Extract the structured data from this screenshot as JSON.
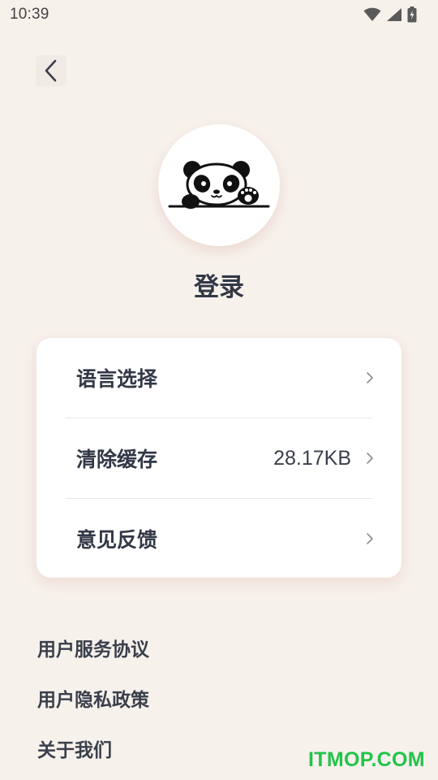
{
  "status_bar": {
    "time": "10:39",
    "icons": [
      "wifi-icon",
      "signal-icon",
      "battery-charging-icon"
    ]
  },
  "header": {
    "back_icon": "chevron-left-icon"
  },
  "profile": {
    "avatar": "panda-avatar",
    "login_label": "登录"
  },
  "settings": {
    "items": [
      {
        "label": "语言选择",
        "value": "",
        "icon": "chevron-right-icon"
      },
      {
        "label": "清除缓存",
        "value": "28.17KB",
        "icon": "chevron-right-icon"
      },
      {
        "label": "意见反馈",
        "value": "",
        "icon": "chevron-right-icon"
      }
    ]
  },
  "links": {
    "items": [
      {
        "label": "用户服务协议"
      },
      {
        "label": "用户隐私政策"
      },
      {
        "label": "关于我们"
      }
    ]
  },
  "watermark": "ITMOP.COM",
  "colors": {
    "background": "#f7f1ec",
    "card": "#ffffff",
    "text": "#323846",
    "watermark": "#22c44a"
  }
}
